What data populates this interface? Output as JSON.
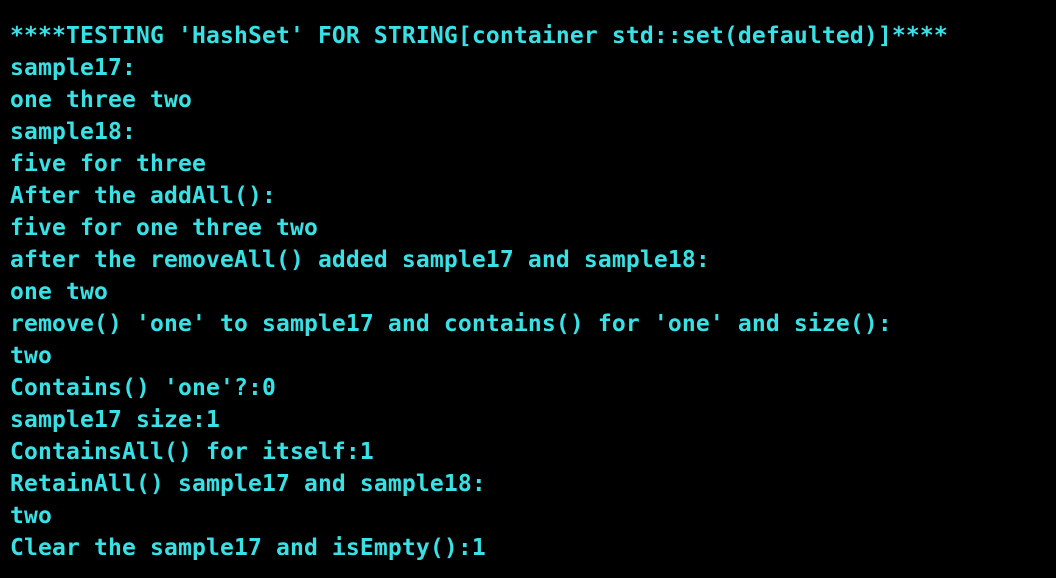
{
  "terminal": {
    "text_color": "#38e1e6",
    "background_color": "#000000",
    "lines": [
      "****TESTING 'HashSet' FOR STRING[container std::set(defaulted)]****",
      "sample17:",
      "one three two",
      "sample18:",
      "five for three",
      "After the addAll():",
      "five for one three two",
      "after the removeAll() added sample17 and sample18:",
      "one two",
      "remove() 'one' to sample17 and contains() for 'one' and size():",
      "two",
      "Contains() 'one'?:0",
      "sample17 size:1",
      "ContainsAll() for itself:1",
      "RetainAll() sample17 and sample18:",
      "two",
      "Clear the sample17 and isEmpty():1"
    ]
  }
}
